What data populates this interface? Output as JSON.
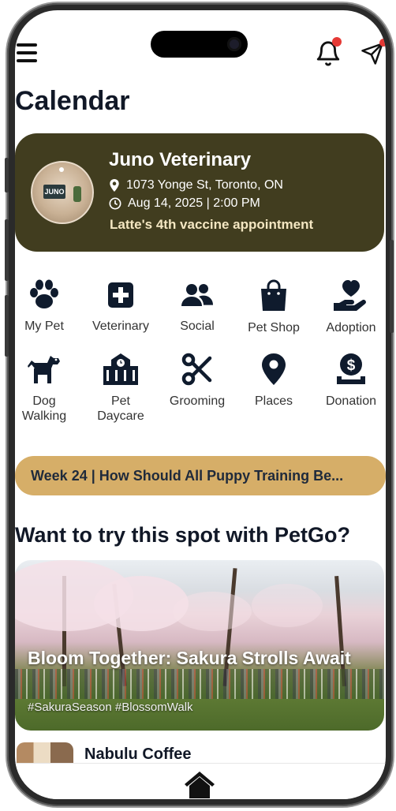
{
  "header": {
    "title": "Calendar",
    "menu_icon": "hamburger-icon",
    "notification_icon": "bell-icon",
    "send_icon": "paper-plane-icon"
  },
  "appointment": {
    "clinic": "Juno Veterinary",
    "address": "1073 Yonge St, Toronto, ON",
    "datetime": "Aug 14, 2025 | 2:00 PM",
    "note": "Latte's 4th vaccine appointment",
    "avatar_sign": "JUNO"
  },
  "services": [
    {
      "label": "My Pet",
      "icon": "paw-icon"
    },
    {
      "label": "Veterinary",
      "icon": "medical-cross-icon"
    },
    {
      "label": "Social",
      "icon": "users-icon"
    },
    {
      "label": "Pet Shop",
      "icon": "shopping-bag-icon"
    },
    {
      "label": "Adoption",
      "icon": "heart-hand-icon"
    },
    {
      "label": "Dog\nWalking",
      "icon": "dog-icon"
    },
    {
      "label": "Pet\nDaycare",
      "icon": "daycare-building-icon"
    },
    {
      "label": "Grooming",
      "icon": "scissors-icon"
    },
    {
      "label": "Places",
      "icon": "map-pin-icon"
    },
    {
      "label": "Donation",
      "icon": "donation-icon"
    }
  ],
  "banner": {
    "text": "Week 24 | How Should All Puppy Training Be..."
  },
  "spots": {
    "section_title": "Want to try this spot with PetGo?",
    "featured": {
      "title": "Bloom Together: Sakura Strolls Await",
      "tags": "#SakuraSeason #BlossomWalk"
    },
    "next": {
      "title": "Nabulu Coffee"
    }
  },
  "tabbar": {
    "home_icon": "home-icon"
  },
  "colors": {
    "card_bg": "#413d1f",
    "banner_bg": "#d6ae68",
    "note_color": "#f4e7c2",
    "badge_red": "#e53935",
    "icon_color": "#0f1b2d"
  }
}
